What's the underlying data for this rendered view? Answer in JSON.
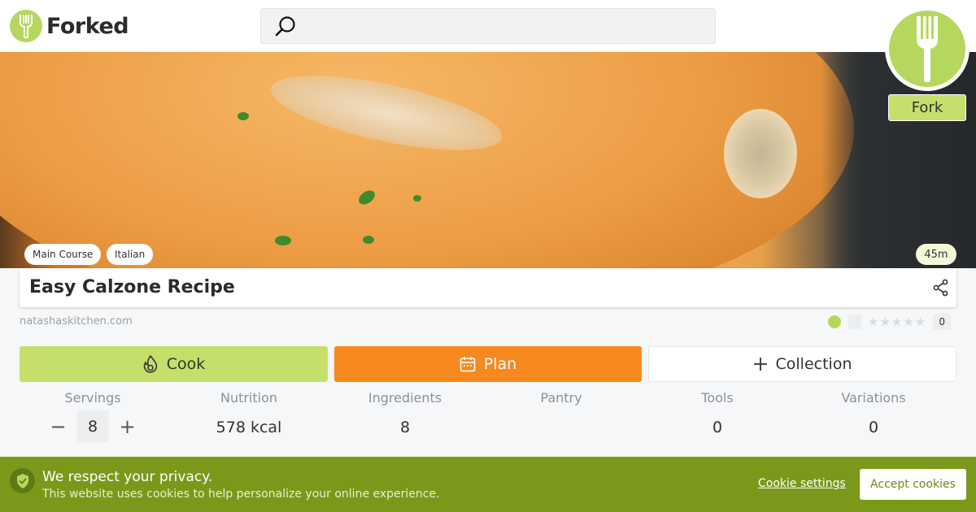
{
  "header": {
    "logo_text": "Forked",
    "search_placeholder": ""
  },
  "hero": {
    "fork_label": "Fork",
    "tags": [
      "Main Course",
      "Italian"
    ],
    "time": "45m"
  },
  "recipe": {
    "title": "Easy Calzone Recipe",
    "source": "natashaskitchen.com",
    "rating_count": "0",
    "stars": "★★★★★"
  },
  "actions": {
    "cook": "Cook",
    "plan": "Plan",
    "collection": "Collection"
  },
  "stats": {
    "servings": {
      "label": "Servings",
      "value": "8",
      "minus": "−",
      "plus": "+"
    },
    "nutrition": {
      "label": "Nutrition",
      "value": "578 kcal"
    },
    "ingredients": {
      "label": "Ingredients",
      "value": "8"
    },
    "pantry": {
      "label": "Pantry",
      "value": ""
    },
    "tools": {
      "label": "Tools",
      "value": "0"
    },
    "variations": {
      "label": "Variations",
      "value": "0"
    }
  },
  "cookie_banner": {
    "title": "We respect your privacy.",
    "text": "This website uses cookies to help personalize your online experience.",
    "settings_label": "Cookie settings",
    "accept_label": "Accept cookies"
  },
  "colors": {
    "brand_green": "#b5d75d",
    "cook_green": "#c5e06a",
    "plan_orange": "#f7891f",
    "banner_green": "#7a991b"
  },
  "icons": [
    "fork-icon",
    "search-icon",
    "share-icon",
    "cook-icon",
    "calendar-icon",
    "plus-icon",
    "shield-check-icon"
  ]
}
